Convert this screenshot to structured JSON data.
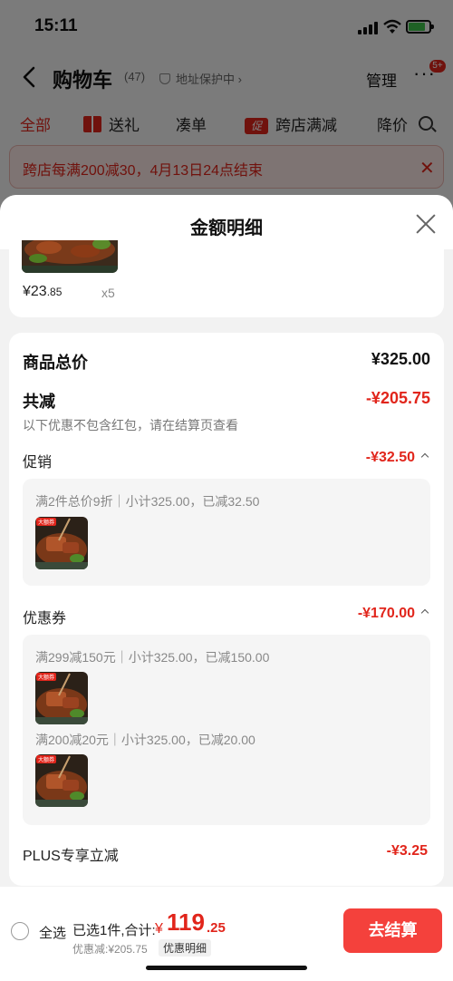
{
  "status_bar": {
    "time": "15:11"
  },
  "nav": {
    "title": "购物车",
    "count": "(47)",
    "address_protect": "地址保护中 ›",
    "manage": "管理",
    "more": "···",
    "badge": "5+"
  },
  "tabs": [
    {
      "label": "全部"
    },
    {
      "label": "送礼"
    },
    {
      "label": "凑单"
    },
    {
      "label": "跨店满减",
      "icon_text": "促"
    },
    {
      "label": "降价"
    }
  ],
  "banner": {
    "text": "跨店每满200减30，4月13日24点结束"
  },
  "sheet": {
    "title": "金额明细",
    "item": {
      "price_int": "¥23",
      "price_dec": ".85",
      "qty": "x5"
    },
    "goods_total": {
      "label": "商品总价",
      "value": "¥325.00"
    },
    "total_discount": {
      "label": "共减",
      "value": "-¥205.75",
      "note": "以下优惠不包含红包，请在结算页查看"
    },
    "promotion": {
      "label": "促销",
      "value": "-¥32.50",
      "detail": "满2件总价9折｜小计325.00，已减32.50"
    },
    "coupon": {
      "label": "优惠券",
      "value": "-¥170.00",
      "details": [
        "满299减150元｜小计325.00，已减150.00",
        "满200减20元｜小计325.00，已减20.00"
      ]
    },
    "plus": {
      "label": "PLUS专享立减",
      "value": "-¥3.25"
    },
    "thumb_tag": "大额券"
  },
  "bottom": {
    "select_all": "全选",
    "summary": "已选1件,合计:",
    "currency": "¥",
    "total_int": "119",
    "total_dec": ".25",
    "discount": "优惠减:¥205.75",
    "detail_link": "优惠明细",
    "checkout": "去结算"
  },
  "colors": {
    "accent": "#e1251b",
    "checkout": "#f4413c"
  }
}
